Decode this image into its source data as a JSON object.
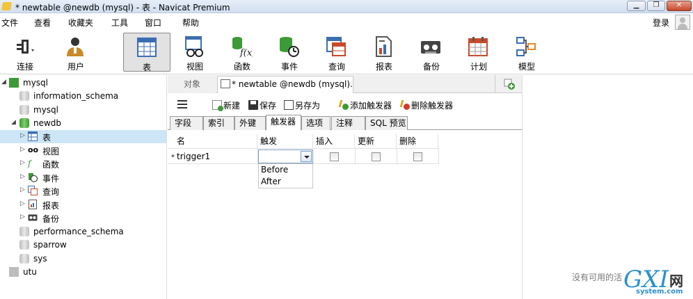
{
  "window": {
    "title": "* newtable @newdb (mysql) - 表 - Navicat Premium",
    "min_label": "▁",
    "max_label": "❐",
    "close_label": "✕"
  },
  "menu": {
    "items": [
      "文件",
      "查看",
      "收藏夹",
      "工具",
      "窗口",
      "帮助"
    ],
    "login": "登录"
  },
  "toolbar": {
    "buttons": [
      {
        "label": "连接",
        "icon": "plug-icon"
      },
      {
        "label": "用户",
        "icon": "user-icon"
      },
      {
        "label": "表",
        "icon": "table-icon",
        "active": true
      },
      {
        "label": "视图",
        "icon": "view-icon"
      },
      {
        "label": "函数",
        "icon": "function-icon"
      },
      {
        "label": "事件",
        "icon": "event-icon"
      },
      {
        "label": "查询",
        "icon": "query-icon"
      },
      {
        "label": "报表",
        "icon": "report-icon"
      },
      {
        "label": "备份",
        "icon": "backup-icon"
      },
      {
        "label": "计划",
        "icon": "schedule-icon"
      },
      {
        "label": "模型",
        "icon": "model-icon"
      }
    ]
  },
  "tree": {
    "nodes": [
      {
        "label": "mysql"
      },
      {
        "label": "information_schema"
      },
      {
        "label": "mysql"
      },
      {
        "label": "newdb"
      },
      {
        "label": "表"
      },
      {
        "label": "视图"
      },
      {
        "label": "函数"
      },
      {
        "label": "事件"
      },
      {
        "label": "查询"
      },
      {
        "label": "报表"
      },
      {
        "label": "备份"
      },
      {
        "label": "performance_schema"
      },
      {
        "label": "sparrow"
      },
      {
        "label": "sys"
      },
      {
        "label": "utu"
      }
    ]
  },
  "tabs": {
    "object": "对象",
    "doc": "* newtable @newdb (mysql)..."
  },
  "actions": {
    "new": "新建",
    "save": "保存",
    "save_as": "另存为",
    "add_trigger": "添加触发器",
    "delete_trigger": "删除触发器"
  },
  "subtabs": [
    "字段",
    "索引",
    "外键",
    "触发器",
    "选项",
    "注释",
    "SQL 预览"
  ],
  "grid": {
    "headers": [
      "名",
      "触发",
      "插入",
      "更新",
      "删除"
    ],
    "row": {
      "marker": "*",
      "name": "trigger1",
      "timing": ""
    },
    "dropdown_options": [
      "Before",
      "After"
    ]
  },
  "right_panel": {
    "empty_message": "没有可用的活"
  },
  "watermark": {
    "logo": "GXI",
    "cn": "网",
    "site": "system.com"
  },
  "colors": {
    "selection": "#cde6f7",
    "accent_green": "#3d9a37",
    "window_chrome": "#d2dff0"
  }
}
